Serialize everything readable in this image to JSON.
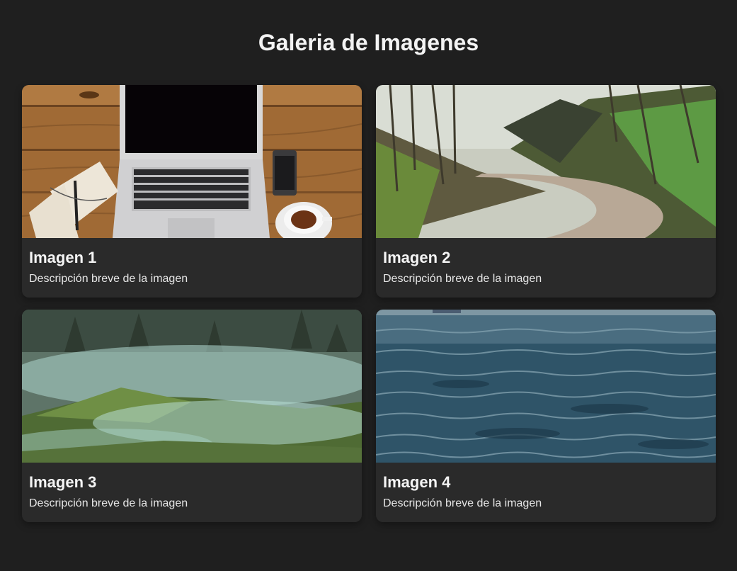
{
  "header": {
    "title": "Galeria de Imagenes"
  },
  "gallery": {
    "cards": [
      {
        "title": "Imagen 1",
        "description": "Descripción breve de la imagen",
        "image": "laptop-desk-photo"
      },
      {
        "title": "Imagen 2",
        "description": "Descripción breve de la imagen",
        "image": "forest-road-photo"
      },
      {
        "title": "Imagen 3",
        "description": "Descripción breve de la imagen",
        "image": "misty-landscape-photo"
      },
      {
        "title": "Imagen 4",
        "description": "Descripción breve de la imagen",
        "image": "sea-water-photo"
      }
    ]
  },
  "colors": {
    "background": "#1f1f1f",
    "card": "#2a2a2a",
    "text": "#f4f4f4"
  }
}
